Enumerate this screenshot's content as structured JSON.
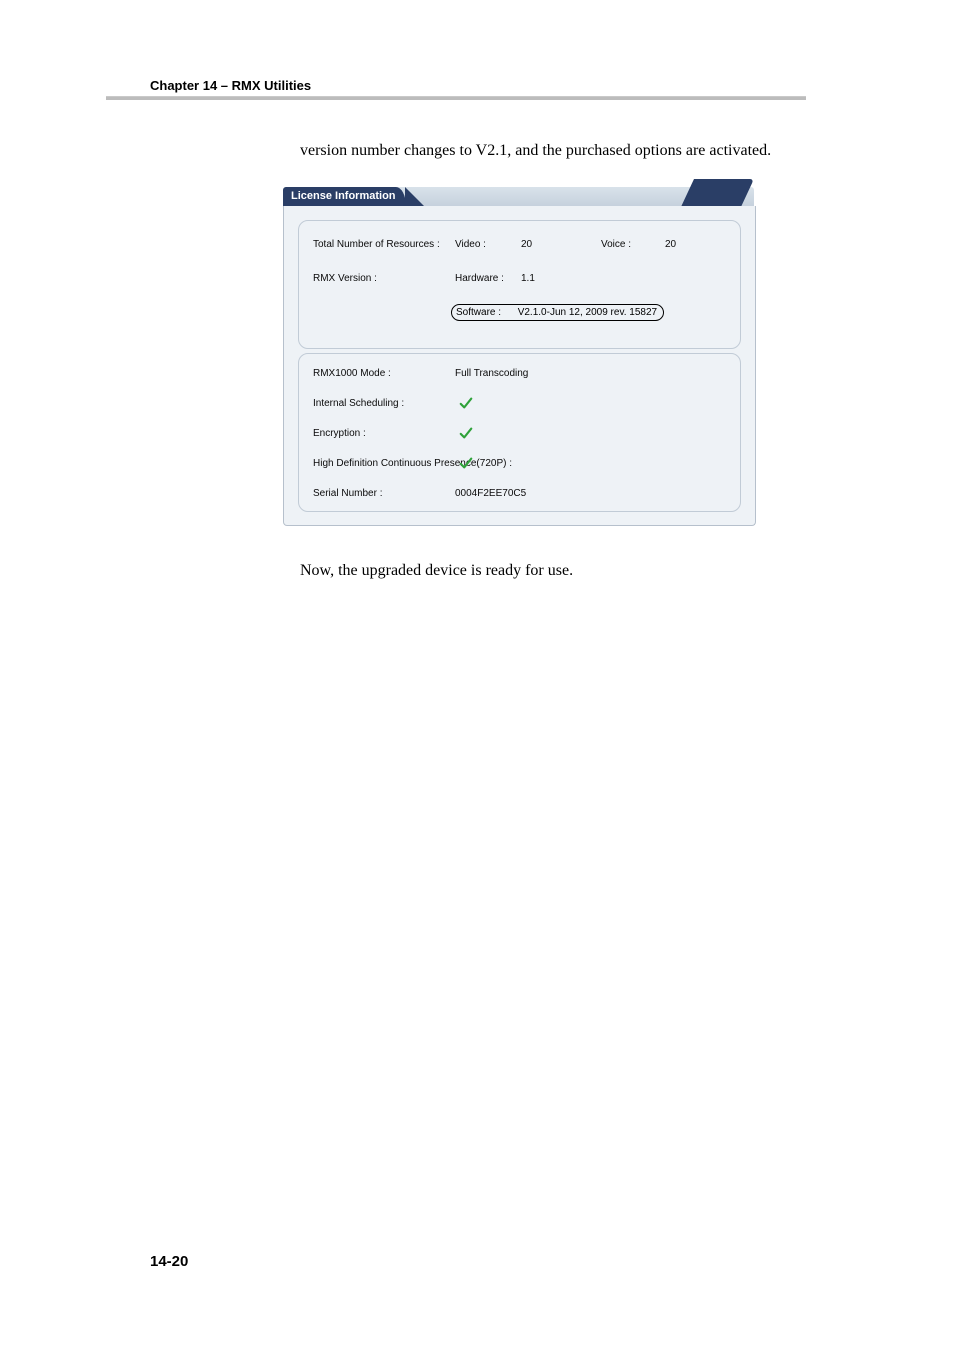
{
  "header": {
    "chapter_line": "Chapter 14 – RMX Utilities"
  },
  "body": {
    "para1": "version number changes to V2.1, and the purchased options are activated.",
    "para2": "Now, the upgraded device is ready for use."
  },
  "page_number": "14-20",
  "license": {
    "tab_title": "License Information",
    "total_resources_label": "Total Number of Resources :",
    "video_label": "Video :",
    "video_value": "20",
    "voice_label": "Voice :",
    "voice_value": "20",
    "rmx_version_label": "RMX Version :",
    "hardware_label": "Hardware :",
    "hardware_value": "1.1",
    "software_label": "Software :",
    "software_value": "V2.1.0-Jun 12, 2009 rev. 15827",
    "mode_label": "RMX1000 Mode :",
    "mode_value": "Full Transcoding",
    "internal_sched_label": "Internal Scheduling :",
    "encryption_label": "Encryption :",
    "hd_label": "High Definition Continuous Presence(720P) :",
    "serial_label": "Serial Number :",
    "serial_value": "0004F2EE70C5"
  }
}
